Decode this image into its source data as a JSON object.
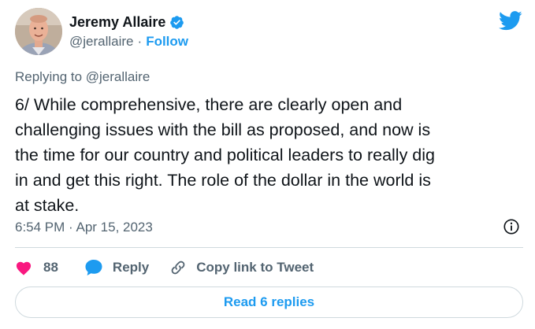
{
  "author": {
    "name": "Jeremy Allaire",
    "handle": "@jerallaire",
    "separator": "·",
    "follow_label": "Follow",
    "verified": true
  },
  "tweet": {
    "replying_to": "Replying to @jerallaire",
    "text": "6/ While comprehensive, there are clearly open and\nchallenging issues with the bill as proposed, and now is\nthe time for our country and political leaders to really dig\nin and get this right.  The role of the dollar in the world is\nat stake.",
    "timestamp": "6:54 PM · Apr 15, 2023"
  },
  "actions": {
    "like_count": "88",
    "reply_label": "Reply",
    "copy_label": "Copy link to Tweet"
  },
  "footer": {
    "read_replies_label": "Read 6 replies"
  },
  "icons": {
    "verified": "verified-badge-icon",
    "brand": "twitter-bird-icon",
    "info": "info-icon",
    "like": "heart-icon",
    "reply": "speech-bubble-icon",
    "copy": "link-icon"
  },
  "colors": {
    "accent": "#1d9bf0",
    "like": "#f91880",
    "text": "#0f1419",
    "muted": "#536471",
    "border": "#cfd9de"
  }
}
